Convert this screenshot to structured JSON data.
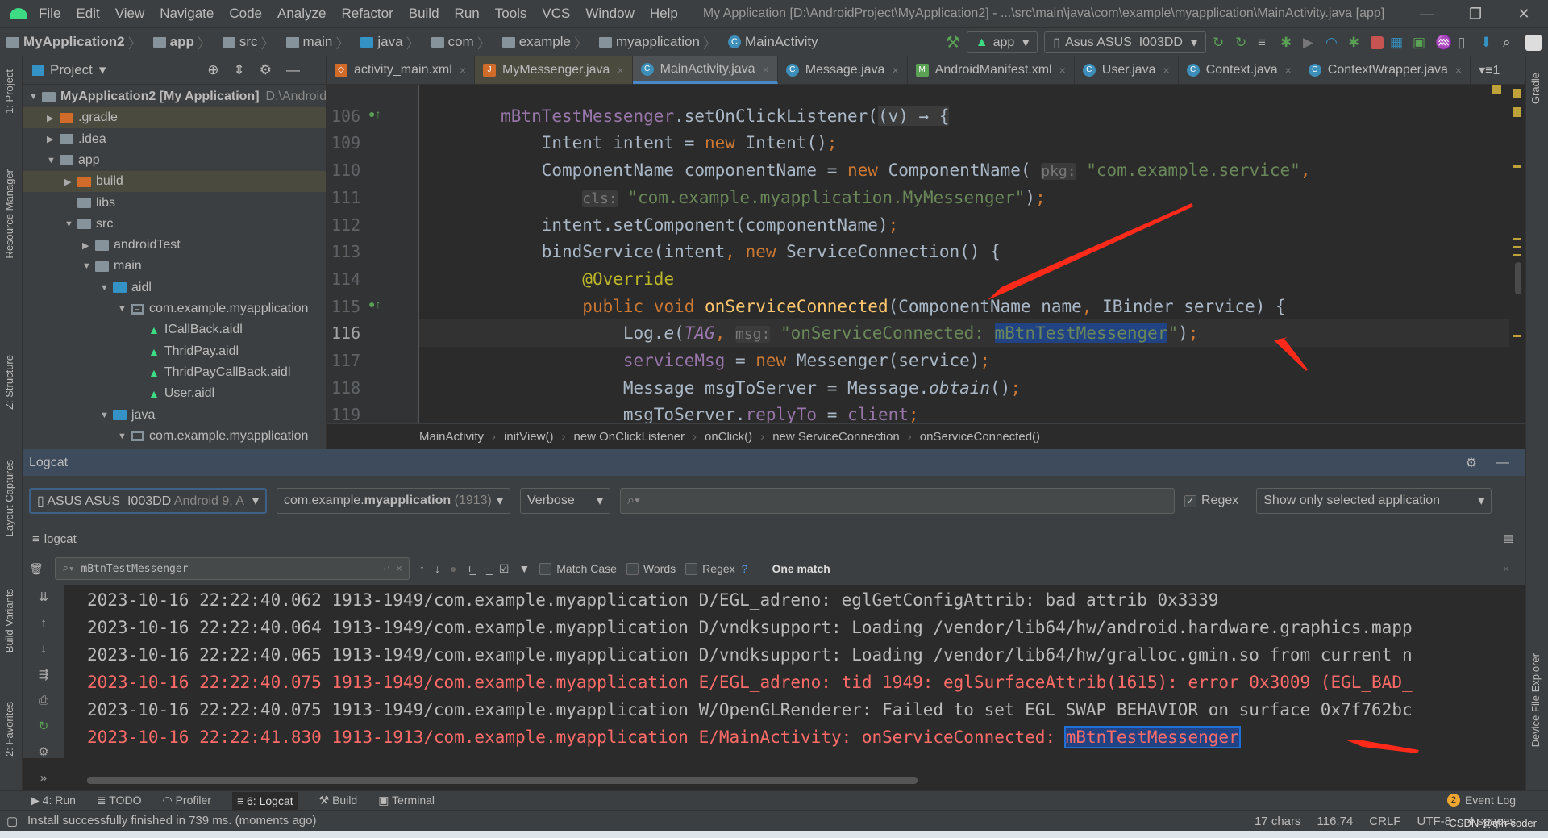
{
  "window": {
    "title": "My Application [D:\\AndroidProject\\MyApplication2] - ...\\src\\main\\java\\com\\example\\myapplication\\MainActivity.java [app]",
    "minimize": "—",
    "maximize": "❐",
    "close": "✕"
  },
  "menu": [
    "File",
    "Edit",
    "View",
    "Navigate",
    "Code",
    "Analyze",
    "Refactor",
    "Build",
    "Run",
    "Tools",
    "VCS",
    "Window",
    "Help"
  ],
  "navbar": {
    "crumbs": [
      "MyApplication2",
      "app",
      "src",
      "main",
      "java",
      "com",
      "example",
      "myapplication",
      "MainActivity"
    ],
    "run_config": "app",
    "device": "Asus ASUS_I003DD"
  },
  "left_strip": [
    "1: Project",
    "Resource Manager",
    "Z: Structure",
    "Layout Captures",
    "Build Variants",
    "2: Favorites"
  ],
  "right_strip": [
    "Gradle",
    "Device File Explorer"
  ],
  "project": {
    "title": "Project",
    "tree": [
      {
        "label": "MyApplication2 [My Application]",
        "extra": "D:\\AndroidProject",
        "depth": 0,
        "arrow": "▼",
        "icon": "folder"
      },
      {
        "label": ".gradle",
        "depth": 1,
        "arrow": "▶",
        "icon": "orange",
        "sel": true
      },
      {
        "label": ".idea",
        "depth": 1,
        "arrow": "▶",
        "icon": "folder"
      },
      {
        "label": "app",
        "depth": 1,
        "arrow": "▼",
        "icon": "folder"
      },
      {
        "label": "build",
        "depth": 2,
        "arrow": "▶",
        "icon": "orange",
        "sel": true
      },
      {
        "label": "libs",
        "depth": 2,
        "arrow": "",
        "icon": "folder"
      },
      {
        "label": "src",
        "depth": 2,
        "arrow": "▼",
        "icon": "folder"
      },
      {
        "label": "androidTest",
        "depth": 3,
        "arrow": "▶",
        "icon": "folder"
      },
      {
        "label": "main",
        "depth": 3,
        "arrow": "▼",
        "icon": "folder"
      },
      {
        "label": "aidl",
        "depth": 4,
        "arrow": "▼",
        "icon": "blue"
      },
      {
        "label": "com.example.myapplication",
        "depth": 5,
        "arrow": "▼",
        "icon": "pkg"
      },
      {
        "label": "ICallBack.aidl",
        "depth": 6,
        "arrow": "",
        "icon": "aidl"
      },
      {
        "label": "ThridPay.aidl",
        "depth": 6,
        "arrow": "",
        "icon": "aidl"
      },
      {
        "label": "ThridPayCallBack.aidl",
        "depth": 6,
        "arrow": "",
        "icon": "aidl"
      },
      {
        "label": "User.aidl",
        "depth": 6,
        "arrow": "",
        "icon": "aidl"
      },
      {
        "label": "java",
        "depth": 4,
        "arrow": "▼",
        "icon": "blue"
      },
      {
        "label": "com.example.myapplication",
        "depth": 5,
        "arrow": "▼",
        "icon": "pkg"
      }
    ]
  },
  "tabs": [
    {
      "label": "activity_main.xml",
      "icon": "xml"
    },
    {
      "label": "MyMessenger.java",
      "icon": "java",
      "hl": true
    },
    {
      "label": "MainActivity.java",
      "icon": "class",
      "active": true
    },
    {
      "label": "Message.java",
      "icon": "class"
    },
    {
      "label": "AndroidManifest.xml",
      "icon": "manifest"
    },
    {
      "label": "User.java",
      "icon": "class"
    },
    {
      "label": "Context.java",
      "icon": "class"
    },
    {
      "label": "ContextWrapper.java",
      "icon": "class"
    }
  ],
  "tabs_overflow": "▾≡1",
  "editor": {
    "current_line": "116",
    "lines": [
      {
        "n": "106",
        "tokens": [
          [
            "        ",
            ""
          ],
          [
            "mBtnTestMessenger",
            "fld"
          ],
          [
            ".setOnClickListener(",
            ""
          ],
          [
            "(v) → {",
            "lam"
          ]
        ]
      },
      {
        "n": "109",
        "tokens": [
          [
            "            Intent intent = ",
            ""
          ],
          [
            "new ",
            "kw"
          ],
          [
            "Intent()",
            ""
          ],
          [
            ";",
            "kw"
          ]
        ]
      },
      {
        "n": "110",
        "tokens": [
          [
            "            ComponentName componentName = ",
            ""
          ],
          [
            "new ",
            "kw"
          ],
          [
            "ComponentName( ",
            ""
          ],
          [
            "pkg:",
            "hint"
          ],
          [
            " ",
            ""
          ],
          [
            "\"com.example.service\"",
            "str"
          ],
          [
            ",",
            "kw"
          ]
        ]
      },
      {
        "n": "111",
        "tokens": [
          [
            "                ",
            ""
          ],
          [
            "cls:",
            "hint"
          ],
          [
            " ",
            ""
          ],
          [
            "\"com.example.myapplication.MyMessenger\"",
            "str"
          ],
          [
            ")",
            ""
          ],
          [
            ";",
            "kw"
          ]
        ]
      },
      {
        "n": "112",
        "tokens": [
          [
            "            intent.setComponent(componentName)",
            ""
          ],
          [
            ";",
            "kw"
          ]
        ]
      },
      {
        "n": "113",
        "tokens": [
          [
            "            bindService(intent",
            ""
          ],
          [
            ", ",
            "kw"
          ],
          [
            "new ",
            "kw"
          ],
          [
            "ServiceConnection() {",
            ""
          ]
        ]
      },
      {
        "n": "114",
        "tokens": [
          [
            "                ",
            ""
          ],
          [
            "@Override",
            "ann"
          ]
        ]
      },
      {
        "n": "115",
        "tokens": [
          [
            "                ",
            ""
          ],
          [
            "public void ",
            "kw"
          ],
          [
            "onServiceConnected",
            "fn"
          ],
          [
            "(ComponentName name",
            ""
          ],
          [
            ", ",
            "kw"
          ],
          [
            "IBinder service) {",
            ""
          ]
        ]
      },
      {
        "n": "116",
        "tokens": [
          [
            "                    Log.",
            ""
          ],
          [
            "e",
            "it"
          ],
          [
            "(",
            ""
          ],
          [
            "TAG",
            "itf"
          ],
          [
            ", ",
            "kw"
          ],
          [
            "msg:",
            "hint"
          ],
          [
            " ",
            ""
          ],
          [
            "\"onServiceConnected: ",
            "str"
          ],
          [
            "mBtnTestMessenger",
            "str selw"
          ],
          [
            "\"",
            "str"
          ],
          [
            ")",
            ""
          ],
          [
            ";",
            "kw"
          ]
        ]
      },
      {
        "n": "117",
        "tokens": [
          [
            "                    ",
            ""
          ],
          [
            "serviceMsg",
            "fld"
          ],
          [
            " = ",
            ""
          ],
          [
            "new ",
            "kw"
          ],
          [
            "Messenger(service)",
            ""
          ],
          [
            ";",
            "kw"
          ]
        ]
      },
      {
        "n": "118",
        "tokens": [
          [
            "                    Message msgToServer = Message.",
            ""
          ],
          [
            "obtain",
            "it"
          ],
          [
            "()",
            ""
          ],
          [
            ";",
            "kw"
          ]
        ]
      },
      {
        "n": "119",
        "tokens": [
          [
            "                    msgToServer.",
            ""
          ],
          [
            "replyTo",
            "fld"
          ],
          [
            " = ",
            ""
          ],
          [
            "client",
            "fld"
          ],
          [
            ";",
            "kw"
          ]
        ]
      }
    ]
  },
  "breadcrumb": [
    "MainActivity",
    "initView()",
    "new OnClickListener",
    "onClick()",
    "new ServiceConnection",
    "onServiceConnected()"
  ],
  "logcat": {
    "title": "Logcat",
    "device": "ASUS ASUS_I003DD",
    "device_extra": "Android 9, A",
    "process_prefix": "com.example.",
    "process_bold": "myapplication",
    "process_pid": "(1913)",
    "level": "Verbose",
    "search_placeholder": "",
    "regex_label": "Regex",
    "regex_checked": true,
    "filter_mode": "Show only selected application",
    "tab": "logcat",
    "find": {
      "value": "mBtnTestMessenger",
      "match_case": "Match Case",
      "words": "Words",
      "regex": "Regex",
      "help": "?",
      "result": "One match"
    },
    "lines": [
      {
        "level": "D",
        "text": "2023-10-16 22:22:40.062 1913-1949/com.example.myapplication D/EGL_adreno: eglGetConfigAttrib: bad attrib 0x3339"
      },
      {
        "level": "D",
        "text": "2023-10-16 22:22:40.064 1913-1949/com.example.myapplication D/vndksupport: Loading /vendor/lib64/hw/android.hardware.graphics.mapp"
      },
      {
        "level": "D",
        "text": "2023-10-16 22:22:40.065 1913-1949/com.example.myapplication D/vndksupport: Loading /vendor/lib64/hw/gralloc.gmin.so from current n"
      },
      {
        "level": "E",
        "text": "2023-10-16 22:22:40.075 1913-1949/com.example.myapplication E/EGL_adreno: tid 1949: eglSurfaceAttrib(1615): error 0x3009 (EGL_BAD_"
      },
      {
        "level": "W",
        "text": "2023-10-16 22:22:40.075 1913-1949/com.example.myapplication W/OpenGLRenderer: Failed to set EGL_SWAP_BEHAVIOR on surface 0x7f762bc"
      },
      {
        "level": "E",
        "text": "2023-10-16 22:22:41.830 1913-1913/com.example.myapplication E/MainActivity: onServiceConnected: ",
        "match": "mBtnTestMessenger"
      }
    ]
  },
  "bottom_tabs": [
    {
      "label": "4: Run"
    },
    {
      "label": "TODO"
    },
    {
      "label": "Profiler"
    },
    {
      "label": "6: Logcat",
      "active": true
    },
    {
      "label": "Build"
    },
    {
      "label": "Terminal"
    }
  ],
  "event_log": {
    "label": "Event Log",
    "count": "2"
  },
  "status": {
    "message": "Install successfully finished in 739 ms. (moments ago)",
    "chars": "17 chars",
    "position": "116:74",
    "line_sep": "CRLF",
    "encoding": "UTF-8",
    "indent": "4 spaces",
    "watermark": "CSDN @qfh-coder"
  },
  "colors": {
    "accent": "#4a88c7",
    "error": "#ff6b68",
    "selection": "#214283",
    "arrow": "#ff2a1a",
    "android": "#3ddc84"
  }
}
